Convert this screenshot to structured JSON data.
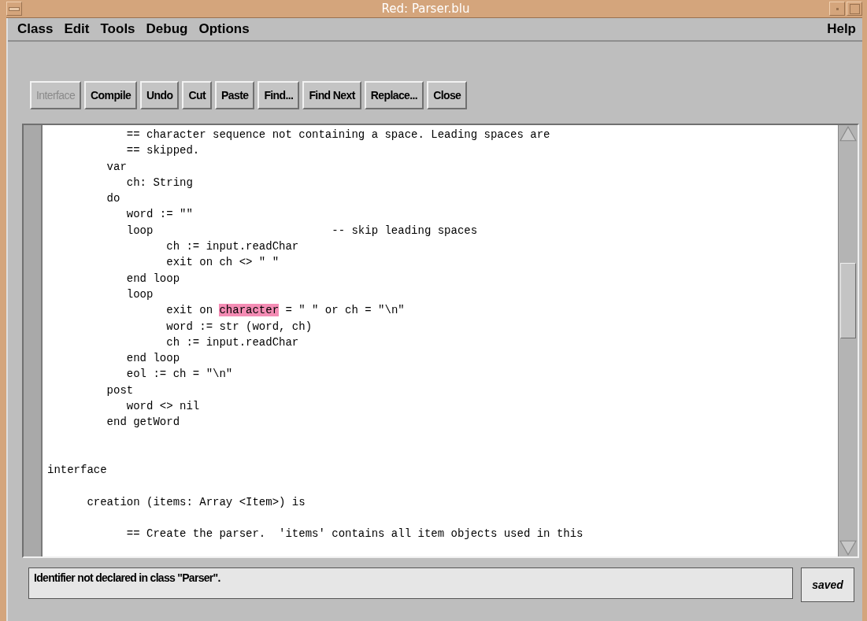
{
  "window": {
    "title": "Red: Parser.blu"
  },
  "menu": {
    "left": [
      {
        "label": "Class"
      },
      {
        "label": "Edit"
      },
      {
        "label": "Tools"
      },
      {
        "label": "Debug"
      },
      {
        "label": "Options"
      }
    ],
    "right": [
      {
        "label": "Help"
      }
    ]
  },
  "toolbar": [
    {
      "label": "Interface",
      "disabled": true
    },
    {
      "label": "Compile",
      "disabled": false
    },
    {
      "label": "Undo",
      "disabled": false
    },
    {
      "label": "Cut",
      "disabled": false
    },
    {
      "label": "Paste",
      "disabled": false
    },
    {
      "label": "Find...",
      "disabled": false
    },
    {
      "label": "Find Next",
      "disabled": false
    },
    {
      "label": "Replace...",
      "disabled": false
    },
    {
      "label": "Close",
      "disabled": false
    }
  ],
  "editor": {
    "lines": [
      {
        "kind": "code",
        "parts": [
          {
            "text": "            == character sequence not containing a space. Leading spaces are",
            "highlighted": false
          }
        ]
      },
      {
        "kind": "code",
        "parts": [
          {
            "text": "            == skipped.",
            "highlighted": false
          }
        ]
      },
      {
        "kind": "code",
        "parts": [
          {
            "text": "         var",
            "highlighted": false
          }
        ]
      },
      {
        "kind": "code",
        "parts": [
          {
            "text": "            ch: String",
            "highlighted": false
          }
        ]
      },
      {
        "kind": "code",
        "parts": [
          {
            "text": "         do",
            "highlighted": false
          }
        ]
      },
      {
        "kind": "code",
        "parts": [
          {
            "text": "            word := \"\"",
            "highlighted": false
          }
        ]
      },
      {
        "kind": "code",
        "parts": [
          {
            "text": "            loop                           -- skip leading spaces",
            "highlighted": false
          }
        ]
      },
      {
        "kind": "code",
        "parts": [
          {
            "text": "                  ch := input.readChar",
            "highlighted": false
          }
        ]
      },
      {
        "kind": "code",
        "parts": [
          {
            "text": "                  exit on ch <> \" \"",
            "highlighted": false
          }
        ]
      },
      {
        "kind": "code",
        "parts": [
          {
            "text": "            end loop",
            "highlighted": false
          }
        ]
      },
      {
        "kind": "code",
        "parts": [
          {
            "text": "            loop",
            "highlighted": false
          }
        ]
      },
      {
        "kind": "code",
        "parts": [
          {
            "text": "                  exit on ",
            "highlighted": false
          },
          {
            "text": "character",
            "highlighted": true
          },
          {
            "text": " = \" \" or ch = \"\\n\"",
            "highlighted": false
          }
        ]
      },
      {
        "kind": "code",
        "parts": [
          {
            "text": "                  word := str (word, ch)",
            "highlighted": false
          }
        ]
      },
      {
        "kind": "code",
        "parts": [
          {
            "text": "                  ch := input.readChar",
            "highlighted": false
          }
        ]
      },
      {
        "kind": "code",
        "parts": [
          {
            "text": "            end loop",
            "highlighted": false
          }
        ]
      },
      {
        "kind": "code",
        "parts": [
          {
            "text": "            eol := ch = \"\\n\"",
            "highlighted": false
          }
        ]
      },
      {
        "kind": "code",
        "parts": [
          {
            "text": "         post",
            "highlighted": false
          }
        ]
      },
      {
        "kind": "code",
        "parts": [
          {
            "text": "            word <> nil",
            "highlighted": false
          }
        ]
      },
      {
        "kind": "code",
        "parts": [
          {
            "text": "         end getWord",
            "highlighted": false
          }
        ]
      },
      {
        "kind": "blank"
      },
      {
        "kind": "blank"
      },
      {
        "kind": "code",
        "parts": [
          {
            "text": "interface",
            "highlighted": false
          }
        ]
      },
      {
        "kind": "blank"
      },
      {
        "kind": "code",
        "parts": [
          {
            "text": "      creation (items: Array <Item>) is",
            "highlighted": false
          }
        ]
      },
      {
        "kind": "blank"
      },
      {
        "kind": "code",
        "parts": [
          {
            "text": "            == Create the parser.  'items' contains all item objects used in this",
            "highlighted": false
          }
        ]
      }
    ]
  },
  "status_bar": {
    "message": "Identifier not declared in class \"Parser\".",
    "state": "saved"
  }
}
